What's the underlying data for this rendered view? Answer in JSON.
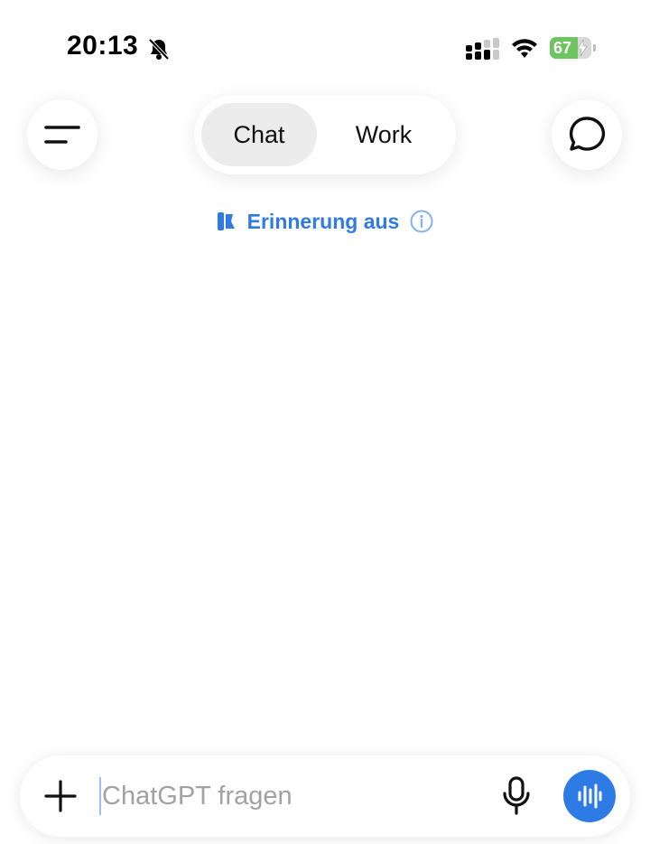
{
  "status_bar": {
    "time": "20:13",
    "battery_level": "67",
    "battery_fraction": 0.67,
    "battery_color": "#6cc55f",
    "icons": [
      "bell-slash-icon",
      "cellular-signal-icon",
      "wifi-icon",
      "battery-charging-icon"
    ]
  },
  "header": {
    "menu_icon": "menu-lines-icon",
    "tabs": [
      {
        "label": "Chat",
        "selected": true
      },
      {
        "label": "Work",
        "selected": false
      }
    ],
    "new_chat_icon": "chat-bubble-icon"
  },
  "memory": {
    "label": "Erinnerung aus",
    "icon": "memory-off-icon",
    "info_icon": "info-icon",
    "color": "#2f7be6"
  },
  "composer": {
    "placeholder": "ChatGPT fragen",
    "value": "",
    "plus_icon": "plus-icon",
    "mic_icon": "microphone-icon",
    "voice_icon": "voice-waveform-icon",
    "accent": "#2f7be6"
  }
}
